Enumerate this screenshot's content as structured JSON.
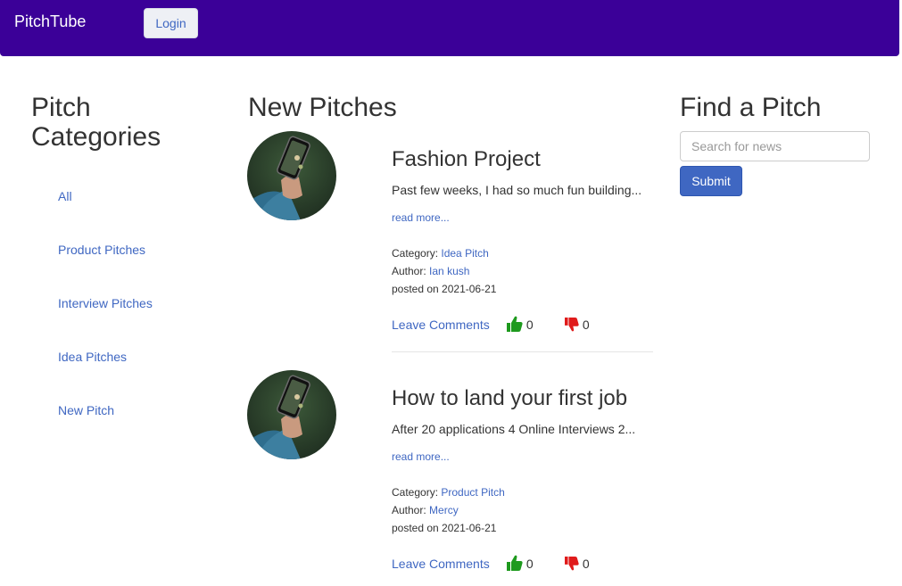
{
  "navbar": {
    "brand": "PitchTube",
    "login_label": "Login",
    "background": "#3b0098"
  },
  "categories": {
    "title": "Pitch Categories",
    "items": [
      {
        "label": "All"
      },
      {
        "label": "Product Pitches"
      },
      {
        "label": "Interview Pitches"
      },
      {
        "label": "Idea Pitches"
      },
      {
        "label": "New Pitch"
      }
    ]
  },
  "pitches": {
    "title": "New Pitches",
    "items": [
      {
        "title": "Fashion Project",
        "description": "Past few weeks, I had so much fun building...",
        "read_more": "read more...",
        "category_label": "Category:",
        "category": "Idea Pitch",
        "author_label": "Author:",
        "author": "Ian kush",
        "posted": "posted on 2021-06-21",
        "comments_label": "Leave Comments",
        "upvotes": "0",
        "downvotes": "0",
        "upvote_icon": "thumbs-up-icon",
        "downvote_icon": "thumbs-down-icon"
      },
      {
        "title": "How to land your first job",
        "description": "After 20 applications 4 Online Interviews 2...",
        "read_more": "read more...",
        "category_label": "Category:",
        "category": "Product Pitch",
        "author_label": "Author:",
        "author": "Mercy",
        "posted": "posted on 2021-06-21",
        "comments_label": "Leave Comments",
        "upvotes": "0",
        "downvotes": "0",
        "upvote_icon": "thumbs-up-icon",
        "downvote_icon": "thumbs-down-icon"
      }
    ]
  },
  "search": {
    "title": "Find a Pitch",
    "placeholder": "Search for news",
    "submit_label": "Submit"
  },
  "colors": {
    "link": "#3f67c2",
    "upvote": "#1e9a1e",
    "downvote": "#e01b1b",
    "submit": "#3f67c2"
  }
}
